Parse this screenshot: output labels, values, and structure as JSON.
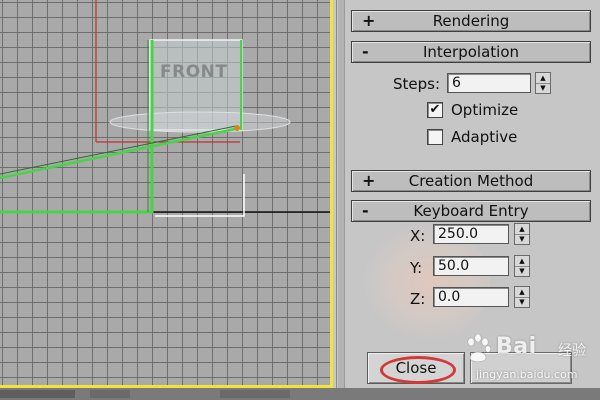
{
  "viewport": {
    "object_label": "FRONT"
  },
  "panel": {
    "rollouts": {
      "rendering": {
        "sign": "+",
        "title": "Rendering"
      },
      "interpolation": {
        "sign": "-",
        "title": "Interpolation"
      },
      "creation_method": {
        "sign": "+",
        "title": "Creation Method"
      },
      "keyboard_entry": {
        "sign": "-",
        "title": "Keyboard Entry"
      }
    },
    "interpolation": {
      "steps_label": "Steps:",
      "steps_value": "6",
      "optimize_label": "Optimize",
      "optimize_checked": true,
      "optimize_mark": "✔",
      "adaptive_label": "Adaptive",
      "adaptive_checked": false
    },
    "keyboard_entry": {
      "x_label": "X:",
      "x_value": "250.0",
      "y_label": "Y:",
      "y_value": "50.0",
      "z_label": "Z:",
      "z_value": "0.0",
      "close_label": "Close"
    }
  },
  "watermark": {
    "brand": "Bai",
    "jingyan": "经验",
    "url": "jingyan.baidu.com"
  },
  "colors": {
    "viewport_border": "#f2e23a",
    "spline": "#4bd24b",
    "close_highlight": "#d23a3a"
  }
}
